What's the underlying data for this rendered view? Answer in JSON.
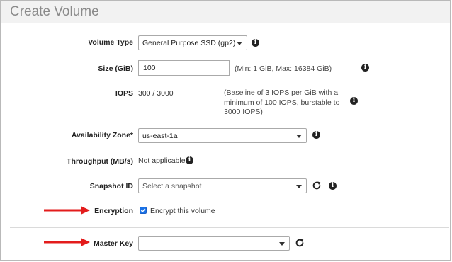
{
  "dialog": {
    "title": "Create Volume"
  },
  "fields": {
    "volume_type": {
      "label": "Volume Type",
      "value": "General Purpose SSD (gp2)"
    },
    "size": {
      "label": "Size (GiB)",
      "value": "100",
      "hint": "(Min: 1 GiB, Max: 16384 GiB)"
    },
    "iops": {
      "label": "IOPS",
      "value": "300 / 3000",
      "hint_lines": [
        "(Baseline of 3 IOPS per GiB with a",
        "minimum of 100 IOPS, burstable to",
        "3000 IOPS)"
      ]
    },
    "availability_zone": {
      "label": "Availability Zone*",
      "value": "us-east-1a"
    },
    "throughput": {
      "label": "Throughput (MB/s)",
      "value": "Not applicable"
    },
    "snapshot": {
      "label": "Snapshot ID",
      "placeholder": "Select a snapshot"
    },
    "encryption": {
      "label": "Encryption",
      "checkbox_label": "Encrypt this volume",
      "checked": true
    },
    "master_key": {
      "label": "Master Key",
      "value": ""
    }
  },
  "icons": {
    "info": "info-icon",
    "refresh": "refresh-icon",
    "arrow": "red-arrow-annotation"
  },
  "colors": {
    "arrow": "#e31c1c",
    "checkbox": "#1a73e8"
  }
}
